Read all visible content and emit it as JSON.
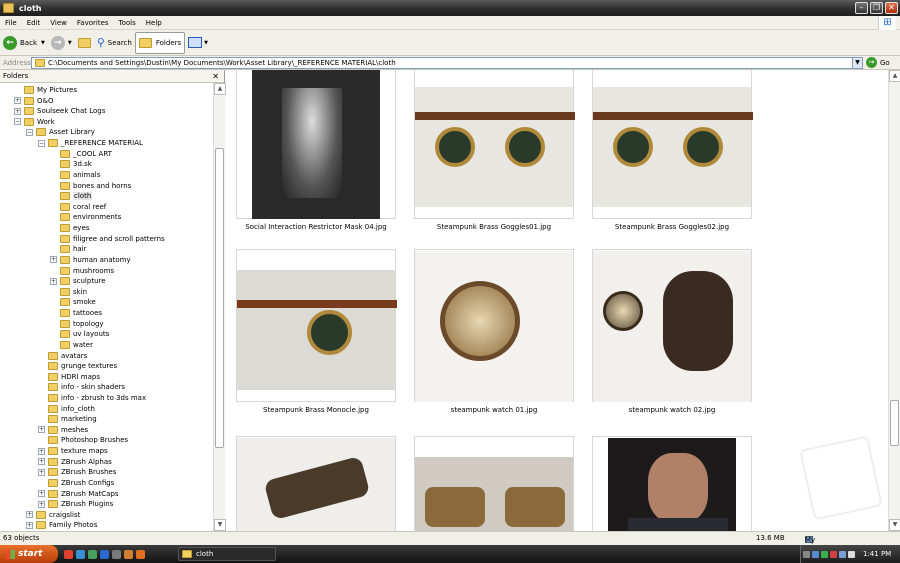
{
  "window": {
    "title": "cloth"
  },
  "menu": [
    "File",
    "Edit",
    "View",
    "Favorites",
    "Tools",
    "Help"
  ],
  "toolbar": {
    "back": "Back",
    "search": "Search",
    "folders": "Folders"
  },
  "address": {
    "label": "Address",
    "path": "C:\\Documents and Settings\\Dustin\\My Documents\\Work\\Asset Library\\_REFERENCE MATERIAL\\cloth",
    "go": "Go"
  },
  "left_pane": {
    "title": "Folders",
    "tree": [
      {
        "label": "My Pictures",
        "indent": 1,
        "expander": ""
      },
      {
        "label": "O&O",
        "indent": 1,
        "expander": "+"
      },
      {
        "label": "Soulseek Chat Logs",
        "indent": 1,
        "expander": "+"
      },
      {
        "label": "Work",
        "indent": 1,
        "expander": "-"
      },
      {
        "label": "Asset Library",
        "indent": 2,
        "expander": "-"
      },
      {
        "label": "_REFERENCE MATERIAL",
        "indent": 3,
        "expander": "-"
      },
      {
        "label": "_COOL ART",
        "indent": 4,
        "expander": ""
      },
      {
        "label": "3d.sk",
        "indent": 4,
        "expander": ""
      },
      {
        "label": "animals",
        "indent": 4,
        "expander": ""
      },
      {
        "label": "bones and horns",
        "indent": 4,
        "expander": ""
      },
      {
        "label": "cloth",
        "indent": 4,
        "expander": "",
        "selected": true
      },
      {
        "label": "coral reef",
        "indent": 4,
        "expander": ""
      },
      {
        "label": "environments",
        "indent": 4,
        "expander": ""
      },
      {
        "label": "eyes",
        "indent": 4,
        "expander": ""
      },
      {
        "label": "filigree and scroll patterns",
        "indent": 4,
        "expander": ""
      },
      {
        "label": "hair",
        "indent": 4,
        "expander": ""
      },
      {
        "label": "human anatomy",
        "indent": 4,
        "expander": "+"
      },
      {
        "label": "mushrooms",
        "indent": 4,
        "expander": ""
      },
      {
        "label": "sculpture",
        "indent": 4,
        "expander": "+"
      },
      {
        "label": "skin",
        "indent": 4,
        "expander": ""
      },
      {
        "label": "smoke",
        "indent": 4,
        "expander": ""
      },
      {
        "label": "tattooes",
        "indent": 4,
        "expander": ""
      },
      {
        "label": "topology",
        "indent": 4,
        "expander": ""
      },
      {
        "label": "uv layouts",
        "indent": 4,
        "expander": ""
      },
      {
        "label": "water",
        "indent": 4,
        "expander": ""
      },
      {
        "label": "avatars",
        "indent": 3,
        "expander": ""
      },
      {
        "label": "grunge textures",
        "indent": 3,
        "expander": ""
      },
      {
        "label": "HDRI maps",
        "indent": 3,
        "expander": ""
      },
      {
        "label": "info - skin shaders",
        "indent": 3,
        "expander": ""
      },
      {
        "label": "info - zbrush to 3ds max",
        "indent": 3,
        "expander": ""
      },
      {
        "label": "info_cloth",
        "indent": 3,
        "expander": ""
      },
      {
        "label": "marketing",
        "indent": 3,
        "expander": ""
      },
      {
        "label": "meshes",
        "indent": 3,
        "expander": "+"
      },
      {
        "label": "Photoshop Brushes",
        "indent": 3,
        "expander": ""
      },
      {
        "label": "texture maps",
        "indent": 3,
        "expander": "+"
      },
      {
        "label": "ZBrush Alphas",
        "indent": 3,
        "expander": "+"
      },
      {
        "label": "ZBrush Brushes",
        "indent": 3,
        "expander": "+"
      },
      {
        "label": "ZBrush Configs",
        "indent": 3,
        "expander": ""
      },
      {
        "label": "ZBrush MatCaps",
        "indent": 3,
        "expander": "+"
      },
      {
        "label": "ZBrush Plugins",
        "indent": 3,
        "expander": "+"
      },
      {
        "label": "craigslist",
        "indent": 2,
        "expander": "+"
      },
      {
        "label": "Family Photos",
        "indent": 2,
        "expander": "+"
      }
    ]
  },
  "files": [
    {
      "name": "Social Interaction Restrictor Mask 04.jpg",
      "kind": "bw"
    },
    {
      "name": "Steampunk Brass Goggles01.jpg",
      "kind": "goggle"
    },
    {
      "name": "Steampunk Brass Goggles02.jpg",
      "kind": "goggle"
    },
    {
      "name": "Steampunk Brass Monocle.jpg",
      "kind": "monocle"
    },
    {
      "name": "steampunk watch 01.jpg",
      "kind": "watch"
    },
    {
      "name": "steampunk watch 02.jpg",
      "kind": "watch2"
    },
    {
      "name": "",
      "kind": "device"
    },
    {
      "name": "",
      "kind": "pair"
    },
    {
      "name": "",
      "kind": "man"
    }
  ],
  "status": {
    "objects": "63 objects",
    "size": "13.6 MB",
    "location": "My Computer"
  },
  "taskbar": {
    "start": "start",
    "task": "cloth",
    "clock": "1:41 PM"
  },
  "colors": {
    "title_bg": "#2b2b2b",
    "chrome": "#f0efe8",
    "start": "#d4581a",
    "go_green": "#3a9a2a"
  }
}
